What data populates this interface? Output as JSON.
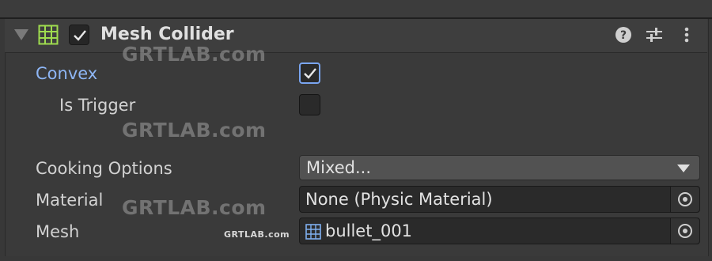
{
  "component": {
    "title": "Mesh Collider",
    "enabled": true,
    "icon": "mesh-grid-icon",
    "header_buttons": [
      "help-icon",
      "preset-sliders-icon",
      "kebab-menu-icon"
    ]
  },
  "properties": {
    "convex": {
      "label": "Convex",
      "checked": true
    },
    "is_trigger": {
      "label": "Is Trigger",
      "checked": false
    },
    "cooking_options": {
      "label": "Cooking Options",
      "value": "Mixed..."
    },
    "material": {
      "label": "Material",
      "value": "None (Physic Material)"
    },
    "mesh": {
      "label": "Mesh",
      "value": "bullet_001",
      "icon": "mesh-grid-icon"
    }
  },
  "watermarks": [
    "GRTLAB.com",
    "GRTLAB.com",
    "GRTLAB.com",
    "GRTLAB.com"
  ],
  "colors": {
    "background": "#383838",
    "active_label": "#8eb6f5",
    "checkbox_accent": "#7aa5f0",
    "component_icon": "#9fdc4f"
  }
}
